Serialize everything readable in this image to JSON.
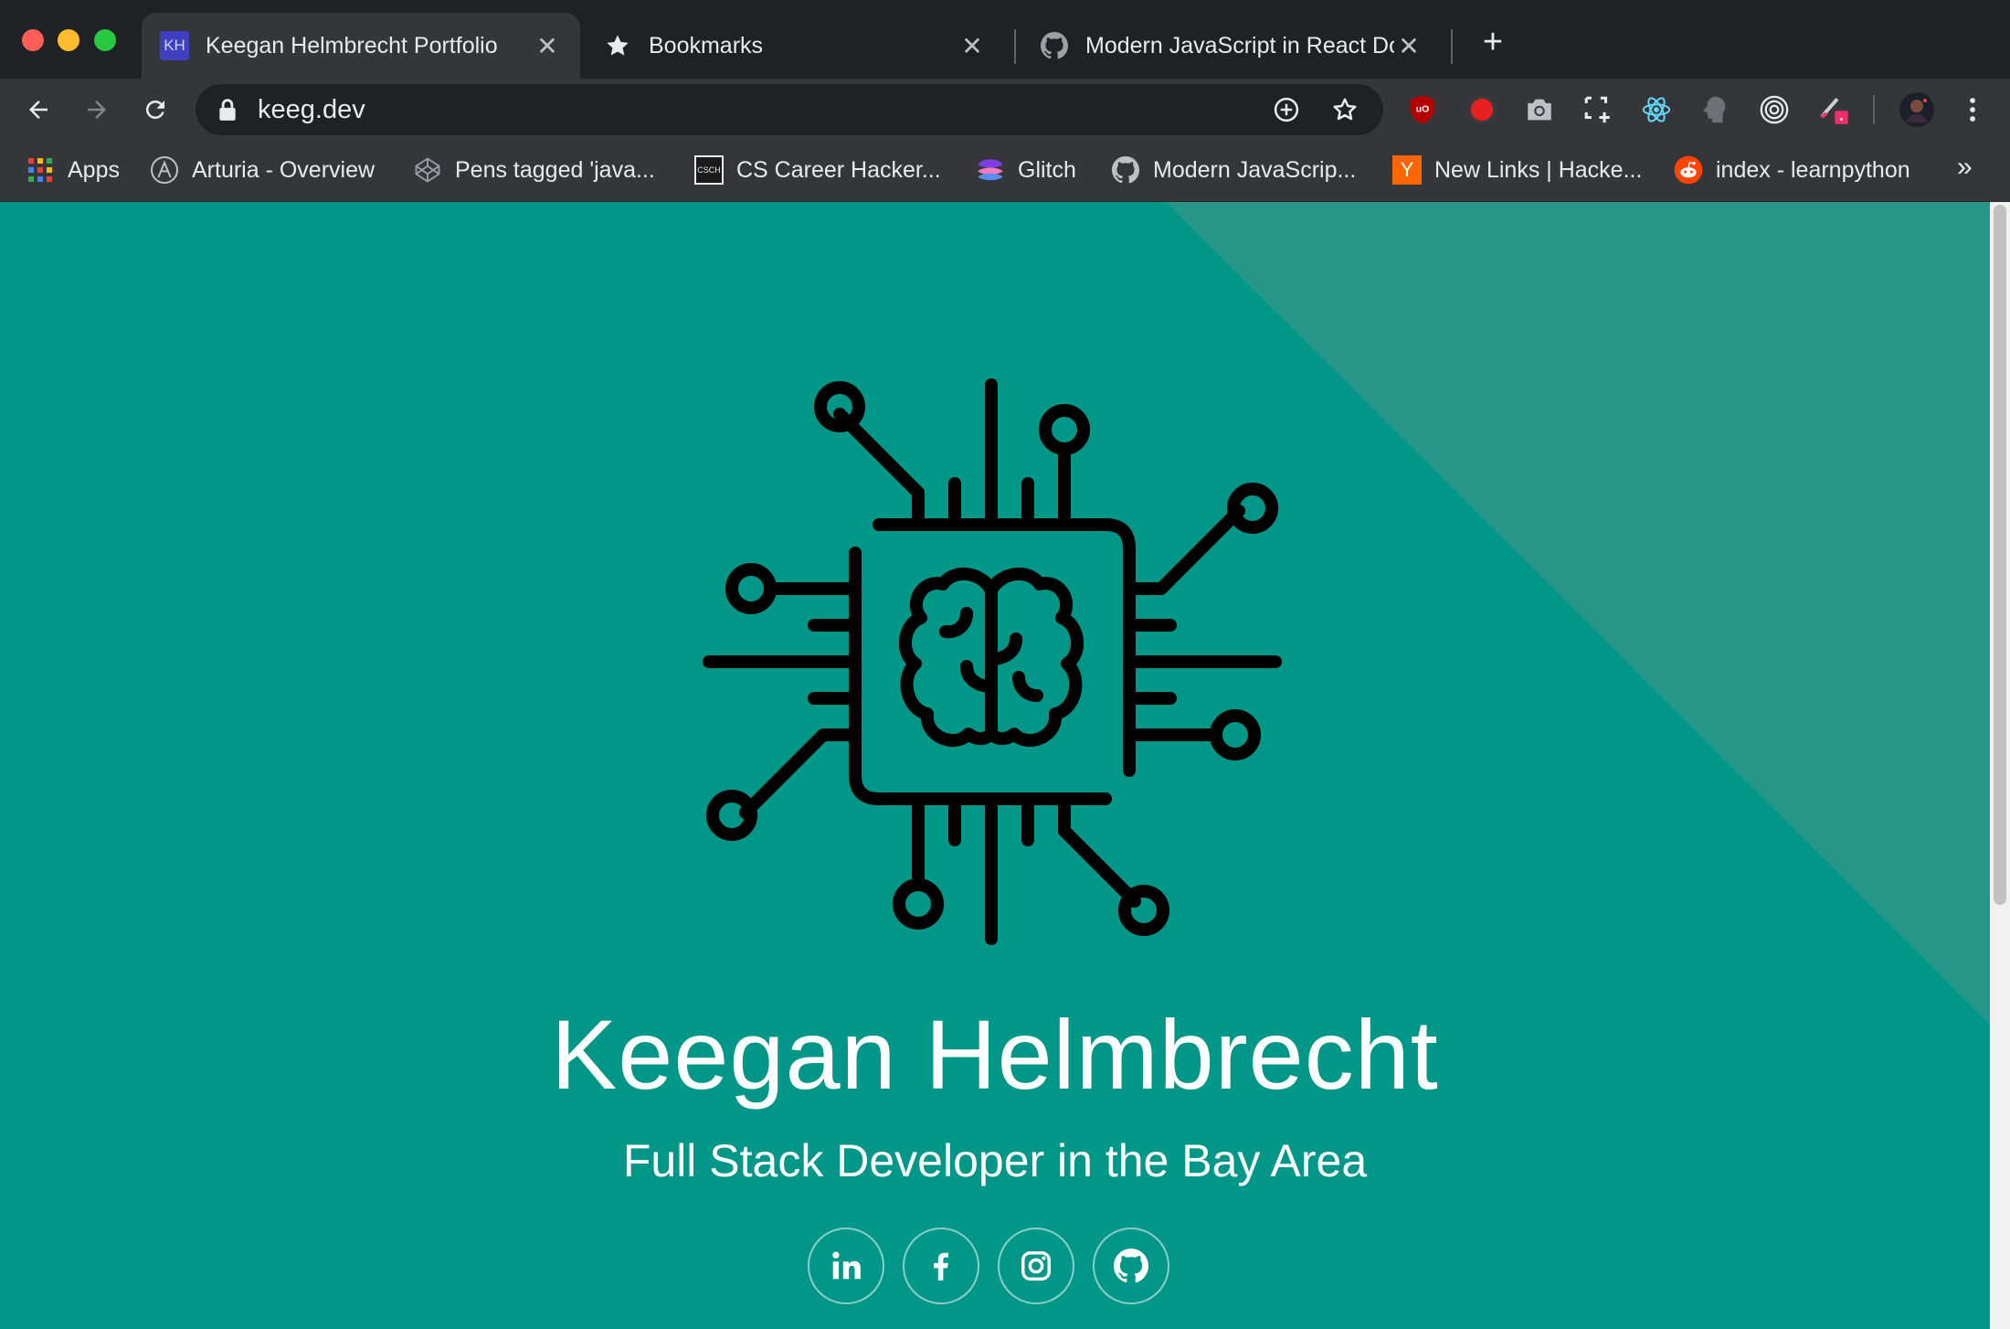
{
  "browser": {
    "tabs": [
      {
        "title": "Keegan Helmbrecht Portfolio",
        "favicon_text": "KH",
        "active": true
      },
      {
        "title": "Bookmarks",
        "active": false
      },
      {
        "title": "Modern JavaScript in React Do",
        "active": false
      }
    ],
    "address_bar": {
      "url": "keeg.dev"
    },
    "bookmarks": [
      {
        "label": "Apps",
        "icon": "apps-grid-icon"
      },
      {
        "label": "Arturia - Overview",
        "icon": "arturia-icon"
      },
      {
        "label": "Pens tagged 'java...",
        "icon": "codepen-icon"
      },
      {
        "label": "CS Career Hacker...",
        "icon": "cs-career-icon",
        "icon_text": "CSCH"
      },
      {
        "label": "Glitch",
        "icon": "glitch-icon"
      },
      {
        "label": "Modern JavaScrip...",
        "icon": "github-icon"
      },
      {
        "label": "New Links | Hacke...",
        "icon": "hacker-news-icon",
        "icon_text": "Y"
      },
      {
        "label": "index - learnpython",
        "icon": "reddit-icon"
      }
    ],
    "more_bookmarks": "»"
  },
  "hero": {
    "name": "Keegan Helmbrecht",
    "subtitle": "Full Stack Developer in the Bay Area",
    "socials": [
      "linkedin",
      "facebook",
      "instagram",
      "github"
    ]
  },
  "colors": {
    "page_bg": "#009688",
    "page_diag": "#26968a",
    "chrome_dark": "#202124",
    "chrome_toolbar": "#35363a"
  }
}
